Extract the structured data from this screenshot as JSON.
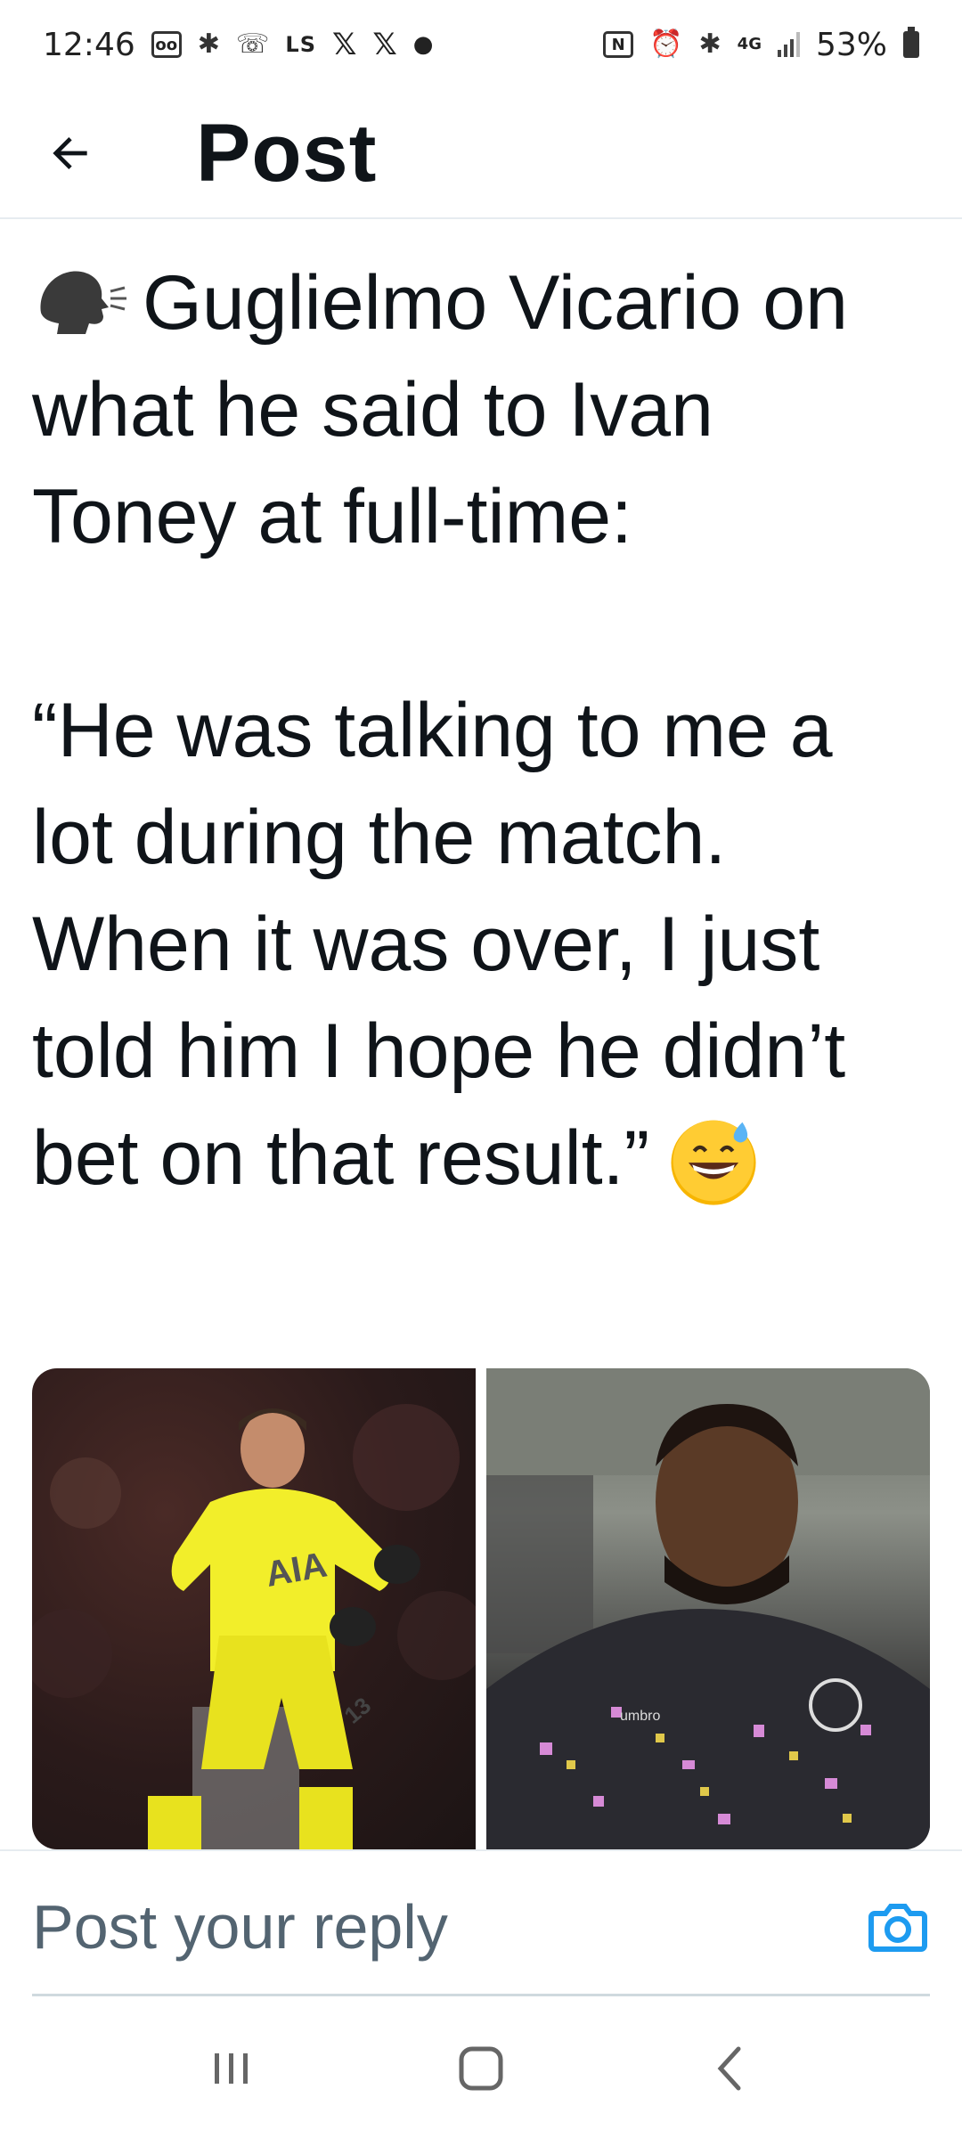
{
  "status_bar": {
    "time": "12:46",
    "ls_label": "LS",
    "network": "4G",
    "battery": "53%",
    "icons": [
      "voicemail-icon",
      "bluetooth-icon",
      "missed-call-icon",
      "ls-icon",
      "x-icon",
      "x-icon",
      "dot-icon",
      "nfc-icon",
      "alarm-icon",
      "bluetooth-icon",
      "network-4g-icon",
      "signal-icon",
      "battery-icon"
    ]
  },
  "header": {
    "title": "Post",
    "back_icon": "arrow-left-icon"
  },
  "post": {
    "text_line1": "Guglielmo Vicario on what he said to Ivan Toney at full-time:",
    "text_quote": "“He was talking to me a lot during the match. When it was over, I just told him I hope he didn’t bet on that result.”",
    "emoji": "grinning-face-with-sweat-emoji",
    "speak_icon": "speaking-head-emoji"
  },
  "media": {
    "images": [
      "goalkeeper-celebration-photo",
      "striker-photo"
    ]
  },
  "reply": {
    "placeholder": "Post your reply",
    "camera_icon": "camera-icon",
    "accent_color": "#1d9bf0"
  },
  "nav": {
    "recents_icon": "recents-icon",
    "home_icon": "home-icon",
    "back_icon": "nav-back-icon"
  }
}
